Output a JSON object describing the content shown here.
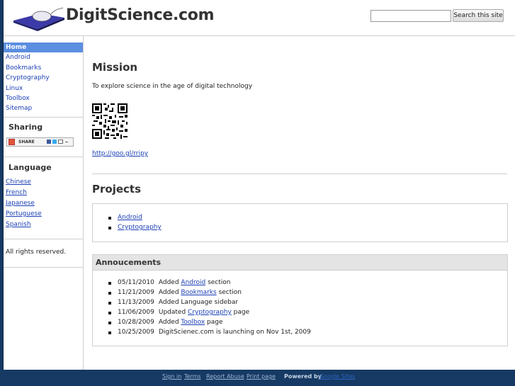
{
  "header": {
    "site_title": "DigitScience.com",
    "search_placeholder": "",
    "search_button": "Search this site"
  },
  "sidebar": {
    "nav": [
      "Home",
      "Android",
      "Bookmarks",
      "Cryptography",
      "Linux",
      "Toolbox",
      "Sitemap"
    ],
    "active": "Home",
    "sharing_heading": "Sharing",
    "share_label": "SHARE",
    "language_heading": "Language",
    "languages": [
      "Chinese",
      "French",
      "Japanese",
      "Portuguese",
      "Spanish"
    ],
    "rights": "All rights reserved."
  },
  "main": {
    "mission_heading": "Mission",
    "mission_text": "To explore science in the age of digital technology",
    "short_link": "http://goo.gl/rripy",
    "projects_heading": "Projects",
    "projects": [
      "Android",
      "Cryptography"
    ],
    "announcements_heading": "Annoucements",
    "announcements": [
      {
        "date": "05/11/2010",
        "pre": "Added ",
        "link": "Android",
        "post": " section"
      },
      {
        "date": "11/21/2009",
        "pre": "Added ",
        "link": "Bookmarks",
        "post": " section"
      },
      {
        "date": "11/13/2009",
        "pre": "Added Language sidebar",
        "link": "",
        "post": ""
      },
      {
        "date": "11/06/2009",
        "pre": "Updated ",
        "link": "Cryptography",
        "post": " page"
      },
      {
        "date": "10/28/2009",
        "pre": "Added ",
        "link": "Toolbox",
        "post": " page"
      },
      {
        "date": "10/25/2009",
        "pre": "DigitScienec.com is launching on Nov 1st, 2009",
        "link": "",
        "post": ""
      }
    ]
  },
  "footer": {
    "links": [
      "Sign in",
      "Terms",
      "Report Abuse",
      "Print page"
    ],
    "powered_by": "Powered by",
    "google_sites": "Google Sites"
  },
  "colors": {
    "page_background": "#163a63",
    "nav_active": "#5b8ee0",
    "link": "#1b3fb5"
  }
}
